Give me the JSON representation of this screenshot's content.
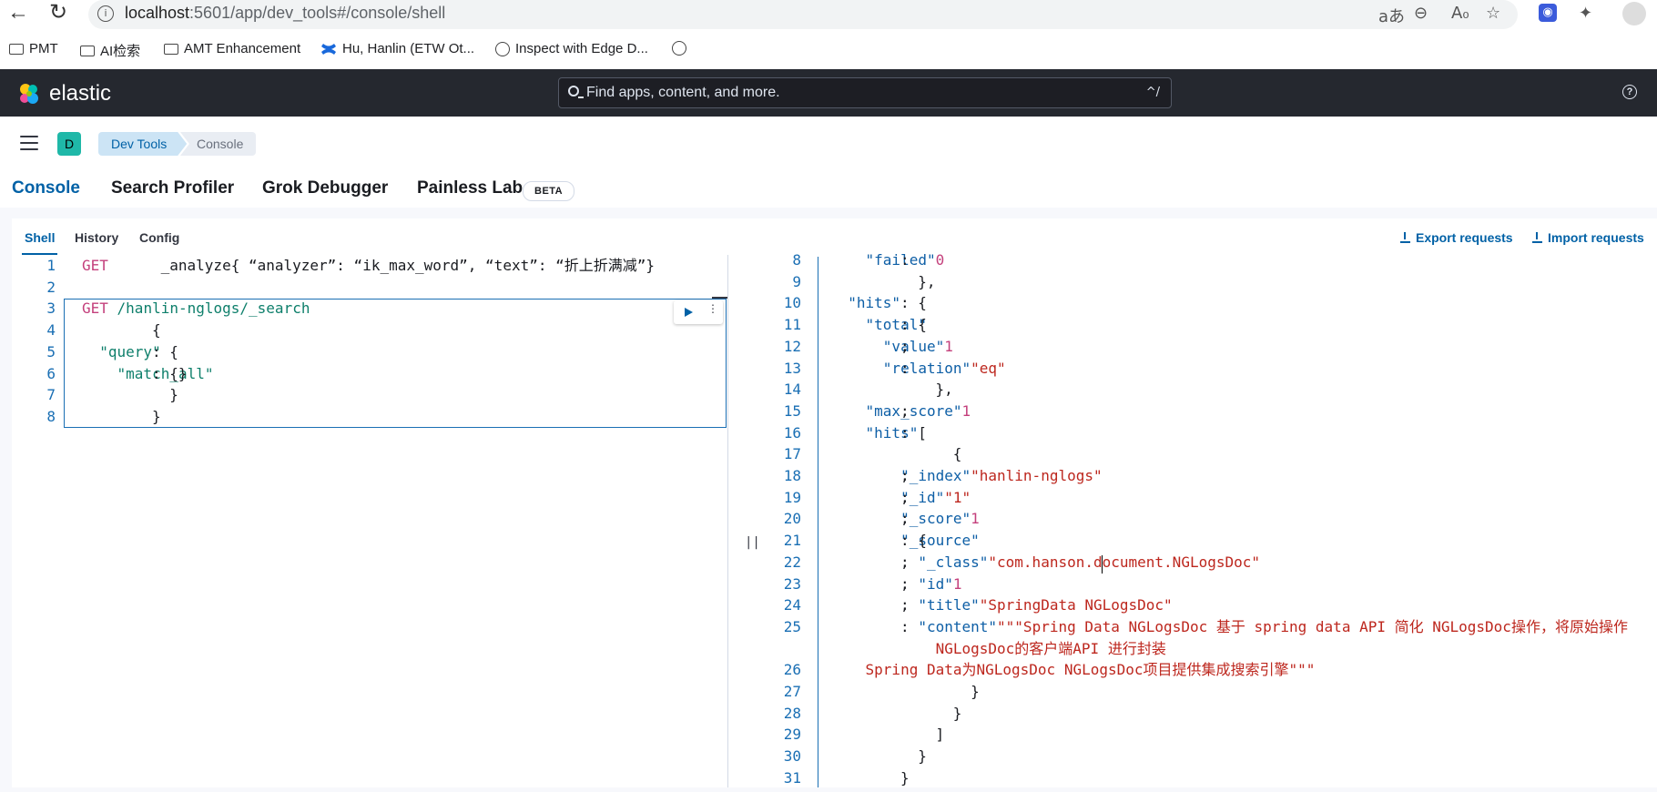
{
  "browser": {
    "url_host": "localhost",
    "url_path": ":5601/app/dev_tools#/console/shell",
    "bookmarks": [
      "PMT",
      "AI检索",
      "AMT Enhancement",
      "Hu, Hanlin (ETW Ot...",
      "Inspect with Edge D..."
    ]
  },
  "header": {
    "logo_text": "elastic",
    "search_placeholder": "Find apps, content, and more.",
    "search_shortcut": "^/",
    "help_label": "?"
  },
  "subheader": {
    "avatar_letter": "D",
    "breadcrumbs": [
      "Dev Tools",
      "Console"
    ]
  },
  "tabs": {
    "main": [
      "Console",
      "Search Profiler",
      "Grok Debugger",
      "Painless Lab"
    ],
    "beta_badge": "BETA",
    "shell": [
      "Shell",
      "History",
      "Config"
    ],
    "export_label": "Export requests",
    "import_label": "Import requests"
  },
  "editor": {
    "lines": [
      {
        "n": "1",
        "parts": [
          [
            "kw",
            "GET"
          ],
          [
            "code",
            " _analyze{ “analyzer”: “ik_max_word”, “text”: “折上折满减”}"
          ]
        ]
      },
      {
        "n": "2",
        "parts": []
      },
      {
        "n": "3",
        "parts": [
          [
            "kw",
            "GET"
          ],
          [
            "str",
            " /hanlin-nglogs/_search"
          ]
        ]
      },
      {
        "n": "4",
        "parts": [
          [
            "code",
            "{"
          ]
        ]
      },
      {
        "n": "5",
        "parts": [
          [
            "key",
            "  \"query\""
          ],
          [
            "code",
            ": {"
          ]
        ]
      },
      {
        "n": "6",
        "parts": [
          [
            "key",
            "    \"match_all\""
          ],
          [
            "code",
            ": {}"
          ]
        ]
      },
      {
        "n": "7",
        "parts": [
          [
            "code",
            "  }"
          ]
        ]
      },
      {
        "n": "8",
        "parts": [
          [
            "code",
            "}"
          ]
        ]
      }
    ]
  },
  "output": {
    "lines": [
      {
        "n": "8",
        "parts": [
          [
            "okey",
            "    \"failed\""
          ],
          [
            "code",
            ": "
          ],
          [
            "num",
            "0"
          ]
        ]
      },
      {
        "n": "9",
        "parts": [
          [
            "code",
            "  },"
          ]
        ]
      },
      {
        "n": "10",
        "parts": [
          [
            "okey",
            "  \"hits\""
          ],
          [
            "code",
            ": {"
          ]
        ]
      },
      {
        "n": "11",
        "parts": [
          [
            "okey",
            "    \"total\""
          ],
          [
            "code",
            ": {"
          ]
        ]
      },
      {
        "n": "12",
        "parts": [
          [
            "okey",
            "      \"value\""
          ],
          [
            "code",
            ": "
          ],
          [
            "num",
            "1"
          ],
          [
            "code",
            ","
          ]
        ]
      },
      {
        "n": "13",
        "parts": [
          [
            "okey",
            "      \"relation\""
          ],
          [
            "code",
            ": "
          ],
          [
            "ostr",
            "\"eq\""
          ]
        ]
      },
      {
        "n": "14",
        "parts": [
          [
            "code",
            "    },"
          ]
        ]
      },
      {
        "n": "15",
        "parts": [
          [
            "okey",
            "    \"max_score\""
          ],
          [
            "code",
            ": "
          ],
          [
            "num",
            "1"
          ],
          [
            "code",
            ","
          ]
        ]
      },
      {
        "n": "16",
        "parts": [
          [
            "okey",
            "    \"hits\""
          ],
          [
            "code",
            ": ["
          ]
        ]
      },
      {
        "n": "17",
        "parts": [
          [
            "code",
            "      {"
          ]
        ]
      },
      {
        "n": "18",
        "parts": [
          [
            "okey",
            "        \"_index\""
          ],
          [
            "code",
            ": "
          ],
          [
            "ostr",
            "\"hanlin-nglogs\""
          ],
          [
            "code",
            ","
          ]
        ]
      },
      {
        "n": "19",
        "parts": [
          [
            "okey",
            "        \"_id\""
          ],
          [
            "code",
            ": "
          ],
          [
            "ostr",
            "\"1\""
          ],
          [
            "code",
            ","
          ]
        ]
      },
      {
        "n": "20",
        "parts": [
          [
            "okey",
            "        \"_score\""
          ],
          [
            "code",
            ": "
          ],
          [
            "num",
            "1"
          ],
          [
            "code",
            ","
          ]
        ]
      },
      {
        "n": "21",
        "parts": [
          [
            "okey",
            "        \"_source\""
          ],
          [
            "code",
            ": {"
          ]
        ]
      },
      {
        "n": "22",
        "parts": [
          [
            "okey",
            "          \"_class\""
          ],
          [
            "code",
            ": "
          ],
          [
            "ostr",
            "\"com.hanson.document.NGLogsDoc\""
          ],
          [
            "code",
            ","
          ]
        ]
      },
      {
        "n": "23",
        "parts": [
          [
            "okey",
            "          \"id\""
          ],
          [
            "code",
            ": "
          ],
          [
            "num",
            "1"
          ],
          [
            "code",
            ","
          ]
        ]
      },
      {
        "n": "24",
        "parts": [
          [
            "okey",
            "          \"title\""
          ],
          [
            "code",
            ": "
          ],
          [
            "ostr",
            "\"SpringData NGLogsDoc\""
          ],
          [
            "code",
            ","
          ]
        ]
      },
      {
        "n": "25",
        "parts": [
          [
            "okey",
            "          \"content\""
          ],
          [
            "code",
            ": "
          ],
          [
            "ostr",
            "\"\"\"Spring Data NGLogsDoc 基于 spring data API 简化 NGLogsDoc操作，将原始操作"
          ]
        ]
      },
      {
        "n": "",
        "parts": [
          [
            "ostr",
            "            NGLogsDoc的客户端API 进行封装"
          ]
        ]
      },
      {
        "n": "26",
        "parts": [
          [
            "ostr",
            "    Spring Data为NGLogsDoc NGLogsDoc项目提供集成搜索引擎\"\"\""
          ]
        ]
      },
      {
        "n": "27",
        "parts": [
          [
            "code",
            "        }"
          ]
        ]
      },
      {
        "n": "28",
        "parts": [
          [
            "code",
            "      }"
          ]
        ]
      },
      {
        "n": "29",
        "parts": [
          [
            "code",
            "    ]"
          ]
        ]
      },
      {
        "n": "30",
        "parts": [
          [
            "code",
            "  }"
          ]
        ]
      },
      {
        "n": "31",
        "parts": [
          [
            "code",
            "}"
          ]
        ]
      }
    ]
  }
}
